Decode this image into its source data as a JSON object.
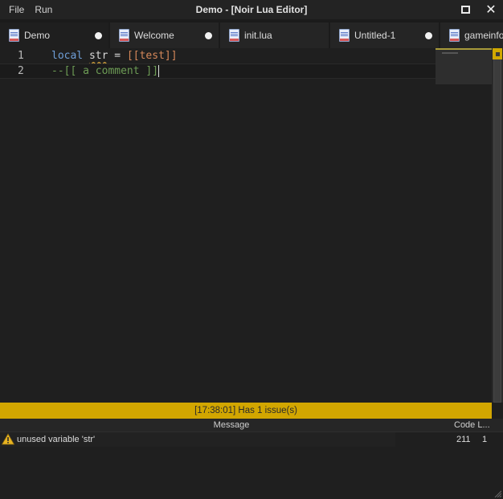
{
  "menu": {
    "file": "File",
    "run": "Run"
  },
  "window": {
    "title": "Demo - [Noir Lua Editor]"
  },
  "tabs": [
    {
      "label": "Demo",
      "modified": true,
      "active": true
    },
    {
      "label": "Welcome",
      "modified": true,
      "active": false
    },
    {
      "label": "init.lua",
      "modified": false,
      "active": false
    },
    {
      "label": "Untitled-1",
      "modified": true,
      "active": false
    },
    {
      "label": "gameinfo...",
      "modified": false,
      "active": false
    }
  ],
  "editor": {
    "line_numbers": [
      "1",
      "2"
    ],
    "line1": {
      "keyword": "local",
      "identifier": "str",
      "operator": "=",
      "string": "[[test]]"
    },
    "line2": {
      "comment": "--[[ a comment ]]"
    }
  },
  "status": {
    "text": "[17:38:01] Has 1 issue(s)",
    "color": "#d2a600"
  },
  "issues": {
    "columns": {
      "message": "Message",
      "code_line": "Code L..."
    },
    "rows": [
      {
        "icon": "warning-icon",
        "message": "unused variable 'str'",
        "code": "211",
        "line": "1"
      }
    ]
  },
  "colors": {
    "keyword": "#6f9fd8",
    "string": "#d6885a",
    "comment": "#6d9c55",
    "warning": "#d2a600"
  }
}
